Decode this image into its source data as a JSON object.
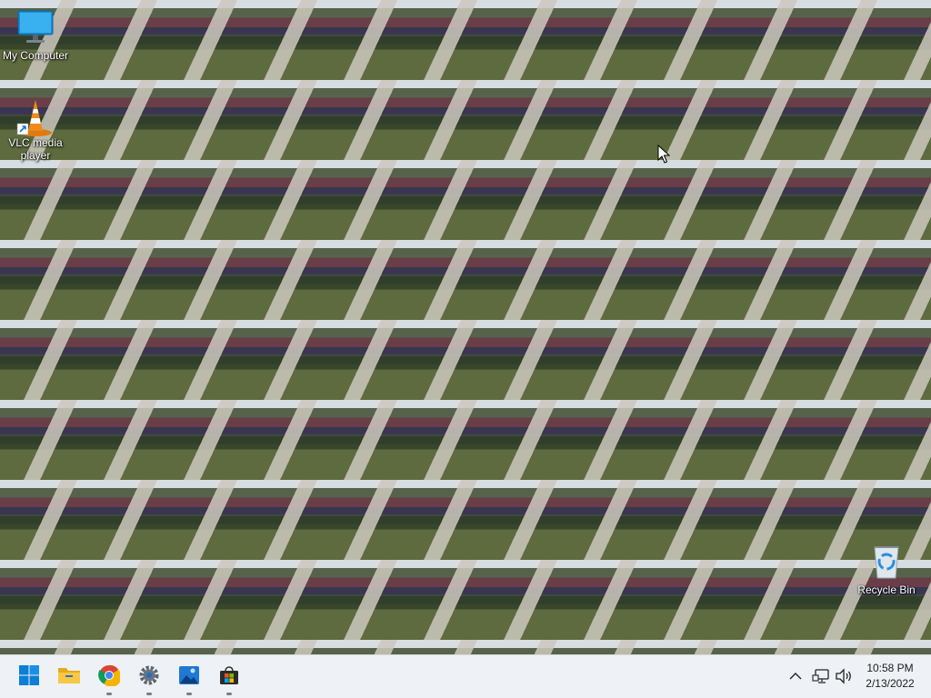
{
  "desktop": {
    "icons": [
      {
        "label": "My Computer",
        "icon": "monitor-icon"
      },
      {
        "label": "VLC media player",
        "icon": "vlc-cone-icon"
      },
      {
        "label": "Recycle Bin",
        "icon": "recycle-bin-icon"
      }
    ]
  },
  "taskbar": {
    "apps": [
      {
        "name": "Start",
        "icon": "windows-start-icon"
      },
      {
        "name": "File Explorer",
        "icon": "folder-icon"
      },
      {
        "name": "Google Chrome",
        "icon": "chrome-icon"
      },
      {
        "name": "Settings",
        "icon": "gear-icon"
      },
      {
        "name": "Photos",
        "icon": "photos-icon"
      },
      {
        "name": "Microsoft Store",
        "icon": "store-bag-icon"
      }
    ],
    "tray": {
      "time": "10:58 PM",
      "date": "2/13/2022"
    }
  },
  "colors": {
    "taskbar_bg": "#eef1f5",
    "windows_blue": "#0a7fd6"
  }
}
